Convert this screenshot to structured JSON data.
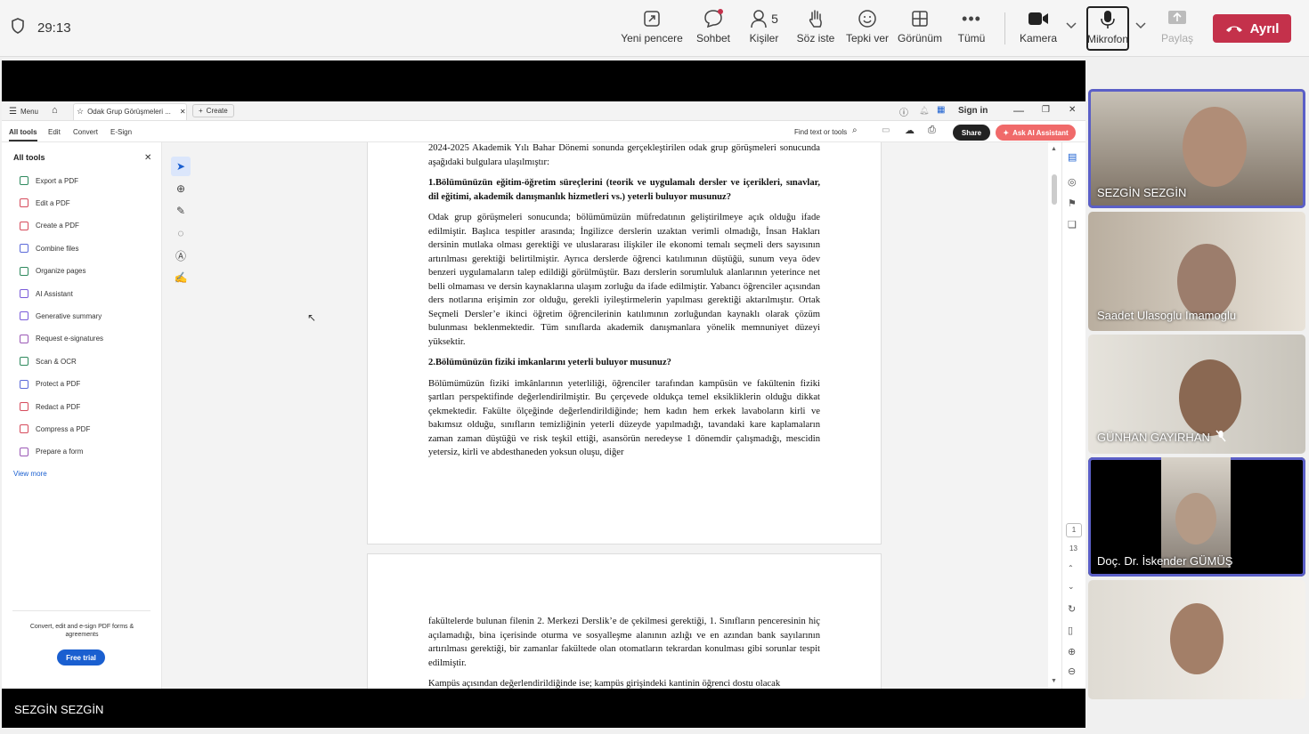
{
  "meeting": {
    "timer": "29:13",
    "buttons": {
      "new_window": "Yeni pencere",
      "chat": "Sohbet",
      "people": "Kişiler",
      "people_count": "5",
      "raise_hand": "Söz iste",
      "react": "Tepki ver",
      "view": "Görünüm",
      "more": "Tümü",
      "camera": "Kamera",
      "mic": "Mikrofon",
      "share": "Paylaş",
      "leave": "Ayrıl"
    },
    "speaker_name": "SEZGİN SEZGİN",
    "participants": [
      {
        "name": "SEZGİN SEZGİN",
        "muted": false
      },
      {
        "name": "Saadet Ulasoglu Imamoglu",
        "muted": false
      },
      {
        "name": "GÜNHAN GAYIRHAN",
        "muted": true
      },
      {
        "name": "Doç. Dr. İskender GÜMÜŞ",
        "muted": false
      },
      {
        "name": "",
        "muted": false
      }
    ],
    "colors": {
      "accent": "#5b5fc7",
      "leave": "#c4314b"
    }
  },
  "acrobat": {
    "menu": "Menu",
    "tab_title": "Odak Grup Görüşmeleri ...",
    "create": "Create",
    "sign_in": "Sign in",
    "tools_tabs": [
      "All tools",
      "Edit",
      "Convert",
      "E-Sign"
    ],
    "find": "Find text or tools",
    "share": "Share",
    "ai_assistant": "Ask AI Assistant",
    "sidebar": {
      "title": "All tools",
      "items": [
        "Export a PDF",
        "Edit a PDF",
        "Create a PDF",
        "Combine files",
        "Organize pages",
        "AI Assistant",
        "Generative summary",
        "Request e-signatures",
        "Scan & OCR",
        "Protect a PDF",
        "Redact a PDF",
        "Compress a PDF",
        "Prepare a form"
      ],
      "item_colors": [
        "#2f8a5e",
        "#d64b5c",
        "#d64b5c",
        "#5b6ad9",
        "#2f8a5e",
        "#7a5bd9",
        "#7a5bd9",
        "#9b59b6",
        "#2f8a5e",
        "#5b6ad9",
        "#d64b5c",
        "#d64b5c",
        "#9b59b6"
      ],
      "view_more": "View more",
      "footer": "Convert, edit and e-sign PDF forms & agreements",
      "free_trial": "Free trial"
    },
    "page_numbers": {
      "current": "1",
      "total": "13"
    },
    "page1": [
      {
        "bold": false,
        "text": "2024-2025 Akademik Yılı Bahar Dönemi sonunda gerçekleştirilen odak grup görüşmeleri sonucunda aşağıdaki bulgulara ulaşılmıştır:"
      },
      {
        "bold": true,
        "text": "1.Bölümünüzün eğitim-öğretim süreçlerini (teorik ve uygulamalı dersler ve içerikleri, sınavlar, dil eğitimi, akademik danışmanlık hizmetleri vs.) yeterli buluyor musunuz?"
      },
      {
        "bold": false,
        "text": "Odak grup görüşmeleri sonucunda; bölümümüzün müfredatının geliştirilmeye açık olduğu ifade edilmiştir. Başlıca tespitler arasında; İngilizce derslerin uzaktan verimli olmadığı, İnsan Hakları dersinin mutlaka olması gerektiği ve uluslararası ilişkiler ile ekonomi temalı seçmeli ders sayısının artırılması gerektiği belirtilmiştir. Ayrıca derslerde öğrenci katılımının düştüğü, sunum veya ödev benzeri uygulamaların talep edildiği görülmüştür. Bazı derslerin sorumluluk alanlarının yeterince net belli olmaması ve dersin kaynaklarına ulaşım zorluğu da ifade edilmiştir. Yabancı öğrenciler açısından ders notlarına erişimin zor olduğu, gerekli iyileştirmelerin yapılması gerektiği aktarılmıştır. Ortak Seçmeli Dersler’e ikinci öğretim öğrencilerinin katılımının zorluğundan kaynaklı olarak çözüm bulunması beklenmektedir. Tüm sınıflarda akademik danışmanlara yönelik memnuniyet düzeyi yüksektir."
      },
      {
        "bold": true,
        "text": "2.Bölümünüzün fiziki imkanlarını yeterli buluyor musunuz?"
      },
      {
        "bold": false,
        "text": "Bölümümüzün fiziki imkânlarının yeterliliği, öğrenciler tarafından kampüsün ve fakültenin fiziki şartları perspektifinde değerlendirilmiştir. Bu çerçevede oldukça temel eksikliklerin olduğu dikkat çekmektedir. Fakülte ölçeğinde değerlendirildiğinde; hem kadın hem erkek lavaboların kirli ve bakımsız olduğu, sınıfların temizliğinin yeterli düzeyde yapılmadığı, tavandaki kare kaplamaların zaman zaman düştüğü ve risk teşkil ettiği, asansörün neredeyse 1 dönemdir çalışmadığı, mescidin yetersiz, kirli ve abdesthaneden yoksun oluşu, diğer"
      }
    ],
    "page2": [
      {
        "bold": false,
        "text": "fakültelerde bulunan filenin 2. Merkezi Derslik’e de çekilmesi gerektiği, 1. Sınıfların penceresinin hiç açılamadığı, bina içerisinde oturma ve sosyalleşme alanının azlığı ve en azından bank sayılarının artırılması gerektiği, bir zamanlar fakültede olan otomatların tekrardan konulması gibi sorunlar tespit edilmiştir."
      },
      {
        "bold": false,
        "text": "Kampüs açısından değerlendirildiğinde ise; kampüs girişindeki kantinin öğrenci dostu olacak"
      }
    ]
  }
}
